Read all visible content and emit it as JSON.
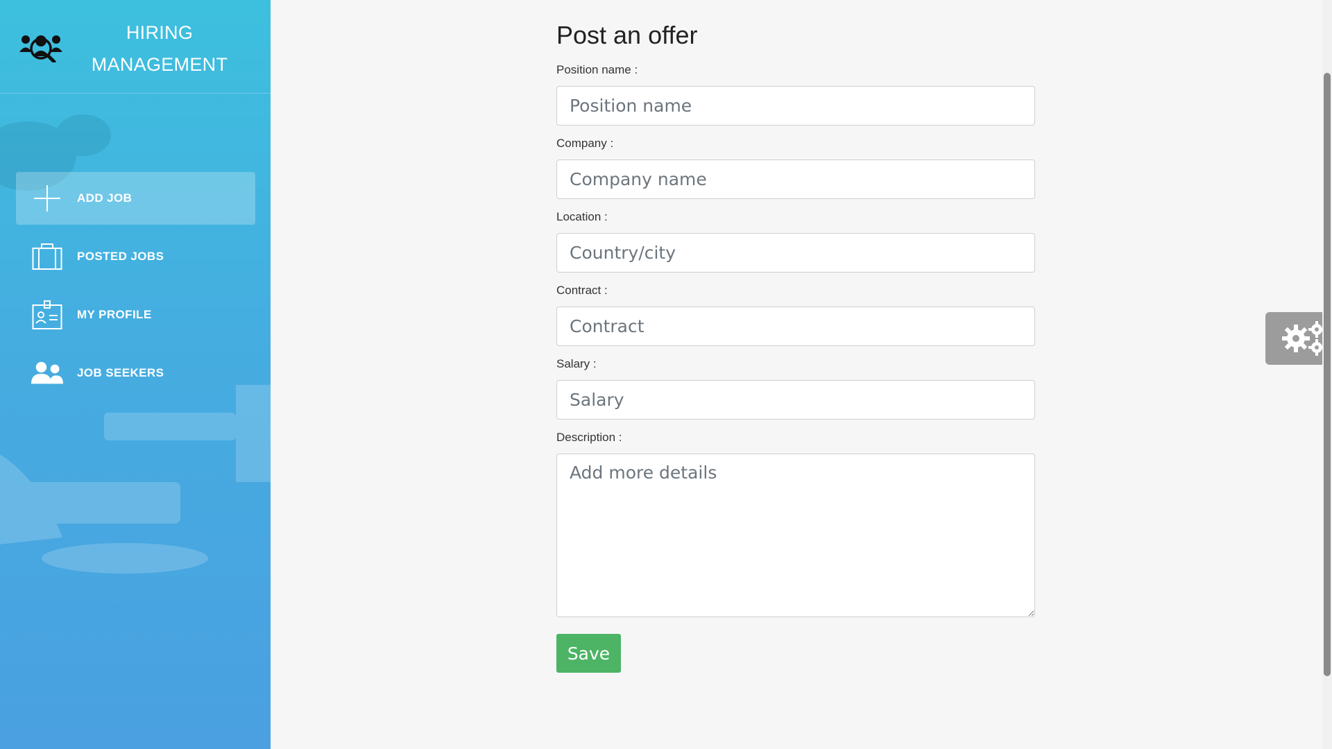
{
  "brand": {
    "title_line1": "HIRING",
    "title_line2": "MANAGEMENT",
    "logo_icon": "team-search-icon"
  },
  "sidebar": {
    "items": [
      {
        "label": "ADD JOB",
        "icon": "plus-icon",
        "active": true
      },
      {
        "label": "POSTED JOBS",
        "icon": "briefcase-icon",
        "active": false
      },
      {
        "label": "MY PROFILE",
        "icon": "id-card-icon",
        "active": false
      },
      {
        "label": "JOB SEEKERS",
        "icon": "users-icon",
        "active": false
      }
    ]
  },
  "form": {
    "title": "Post an offer",
    "position": {
      "label": "Position name :",
      "placeholder": "Position name",
      "value": ""
    },
    "company": {
      "label": "Company :",
      "placeholder": "Company name",
      "value": ""
    },
    "location": {
      "label": "Location :",
      "placeholder": "Country/city",
      "value": ""
    },
    "contract": {
      "label": "Contract :",
      "placeholder": "Contract",
      "value": ""
    },
    "salary": {
      "label": "Salary :",
      "placeholder": "Salary",
      "value": ""
    },
    "description": {
      "label": "Description :",
      "placeholder": "Add more details",
      "value": ""
    },
    "save_label": "Save"
  },
  "colors": {
    "sidebar_top": "#3dc0de",
    "sidebar_bottom": "#4aa0e0",
    "save_button": "#4cb464",
    "settings_tab": "#9c9c9c"
  }
}
